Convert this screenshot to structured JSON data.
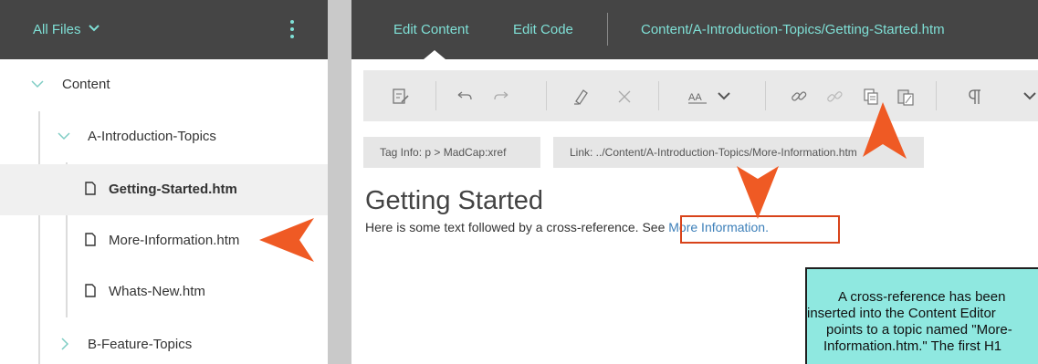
{
  "left_panel": {
    "title": "All Files",
    "tree": [
      {
        "label": "Content"
      },
      {
        "label": "A-Introduction-Topics"
      },
      {
        "label": "Getting-Started.htm"
      },
      {
        "label": "More-Information.htm"
      },
      {
        "label": "Whats-New.htm"
      },
      {
        "label": "B-Feature-Topics"
      }
    ]
  },
  "editor": {
    "tabs": [
      {
        "label": "Edit Content"
      },
      {
        "label": "Edit Code"
      }
    ],
    "file_path": "Content/A-Introduction-Topics/Getting-Started.htm",
    "toolbar_icons": [
      "track-changes-icon",
      "undo-icon",
      "redo-icon",
      "highlight-icon",
      "clear-icon",
      "font-size-icon",
      "chevron-down-icon",
      "link-icon",
      "unlink-icon",
      "copy-icon",
      "paste-icon",
      "paragraph-mark-icon",
      "chevron-down-icon"
    ],
    "tag_info": "Tag Info: p > MadCap:xref",
    "link_info": "Link: ../Content/A-Introduction-Topics/More-Information.htm",
    "doc": {
      "heading": "Getting Started",
      "body_text": "Here is some text followed by a cross-reference. See ",
      "link_text": "More Information",
      "body_end": "."
    }
  },
  "note": {
    "lines": [
      "A cross-reference has been",
      "inserted into the Content Editor",
      "points to a topic named \"More-",
      "Information.htm.\" The first H1"
    ]
  },
  "colors": {
    "header_bg": "#454545",
    "accent_teal": "#7fe0d6",
    "callout_orange": "#ef5a24",
    "note_bg": "#8fe8e0",
    "link_blue": "#3c7fb9"
  }
}
